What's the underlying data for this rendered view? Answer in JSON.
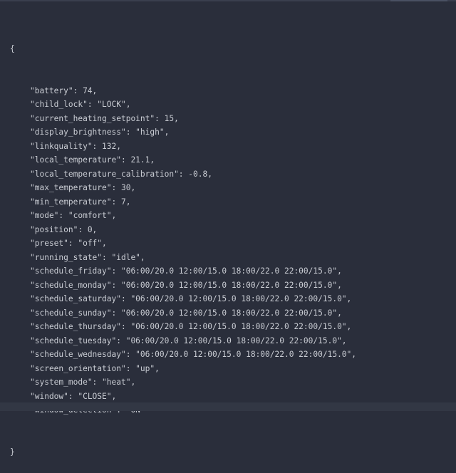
{
  "json_viewer": {
    "open_brace": "{",
    "close_brace": "}",
    "entries": [
      "\"battery\": 74,",
      "\"child_lock\": \"LOCK\",",
      "\"current_heating_setpoint\": 15,",
      "\"display_brightness\": \"high\",",
      "\"linkquality\": 132,",
      "\"local_temperature\": 21.1,",
      "\"local_temperature_calibration\": -0.8,",
      "\"max_temperature\": 30,",
      "\"min_temperature\": 7,",
      "\"mode\": \"comfort\",",
      "\"position\": 0,",
      "\"preset\": \"off\",",
      "\"running_state\": \"idle\",",
      "\"schedule_friday\": \"06:00/20.0 12:00/15.0 18:00/22.0 22:00/15.0\",",
      "\"schedule_monday\": \"06:00/20.0 12:00/15.0 18:00/22.0 22:00/15.0\",",
      "\"schedule_saturday\": \"06:00/20.0 12:00/15.0 18:00/22.0 22:00/15.0\",",
      "\"schedule_sunday\": \"06:00/20.0 12:00/15.0 18:00/22.0 22:00/15.0\",",
      "\"schedule_thursday\": \"06:00/20.0 12:00/15.0 18:00/22.0 22:00/15.0\",",
      "\"schedule_tuesday\": \"06:00/20.0 12:00/15.0 18:00/22.0 22:00/15.0\",",
      "\"schedule_wednesday\": \"06:00/20.0 12:00/15.0 18:00/22.0 22:00/15.0\",",
      "\"screen_orientation\": \"up\",",
      "\"system_mode\": \"heat\",",
      "\"window\": \"CLOSE\",",
      "\"window_detection\": \"ON\""
    ]
  },
  "colors": {
    "background": "#2a2e3b",
    "text": "#c9ccd3"
  }
}
